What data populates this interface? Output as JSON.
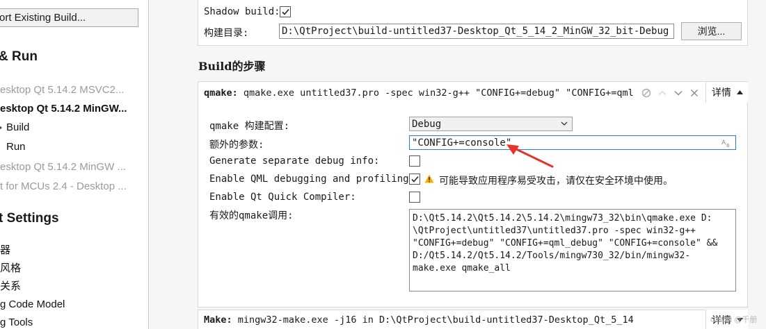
{
  "sidebar": {
    "import_button": "ort Existing Build...",
    "heading_build_run": "& Run",
    "kits": [
      {
        "label": "esktop Qt 5.14.2 MSVC2...",
        "style": "dim"
      },
      {
        "label": "esktop Qt 5.14.2 MinGW...",
        "style": "bold"
      }
    ],
    "build_item": "Build",
    "run_item": "Run",
    "more_kits": [
      {
        "label": "esktop Qt 5.14.2 MinGW ..."
      },
      {
        "label": "t for MCUs 2.4 - Desktop ..."
      }
    ],
    "heading_project_settings": "t Settings",
    "settings_items": [
      "器",
      "风格",
      "关系",
      "g Code Model",
      "g Tools"
    ]
  },
  "general": {
    "shadow_build_label": "Shadow build:",
    "shadow_build_checked": true,
    "build_dir_label": "构建目录:",
    "build_dir_value": "D:\\QtProject\\build-untitled37-Desktop_Qt_5_14_2_MinGW_32_bit-Debug",
    "browse_button": "浏览..."
  },
  "steps": {
    "heading": "Build的步骤",
    "qmake": {
      "title_bold": "qmake:",
      "title_rest": " qmake.exe untitled37.pro -spec win32-g++ \"CONFIG+=debug\" \"CONFIG+=qml",
      "details_button": "详情",
      "config_label": "qmake 构建配置:",
      "config_value": "Debug",
      "extra_args_label": "额外的参数:",
      "extra_args_value": "\"CONFIG+=console\"",
      "separate_debug_label": "Generate separate debug info:",
      "separate_debug_checked": false,
      "qml_debug_label": "Enable QML debugging and profiling:",
      "qml_debug_checked": true,
      "qml_warning": "可能导致应用程序易受攻击，请仅在安全环境中使用。",
      "quick_compiler_label": "Enable Qt Quick Compiler:",
      "quick_compiler_checked": false,
      "effective_label": "有效的qmake调用:",
      "effective_lines": [
        "D:\\Qt5.14.2\\Qt5.14.2\\5.14.2\\mingw73_32\\bin\\qmake.exe D:",
        "\\QtProject\\untitled37\\untitled37.pro -spec win32-g++",
        "\"CONFIG+=debug\" \"CONFIG+=qml_debug\" \"CONFIG+=console\" &&",
        "D:/Qt5.14.2/Qt5.14.2/Tools/mingw730_32/bin/mingw32-",
        "make.exe qmake_all"
      ]
    },
    "make": {
      "title_bold": "Make:",
      "title_rest": " mingw32-make.exe -j16 in D:\\QtProject\\build-untitled37-Desktop_Qt_5_14",
      "details_button": "详情"
    }
  },
  "watermark": "CSDN @千册",
  "colors": {
    "accent_border": "#2b7bd6",
    "annotation_arrow": "#e8332a",
    "warning": "#f5b400"
  }
}
